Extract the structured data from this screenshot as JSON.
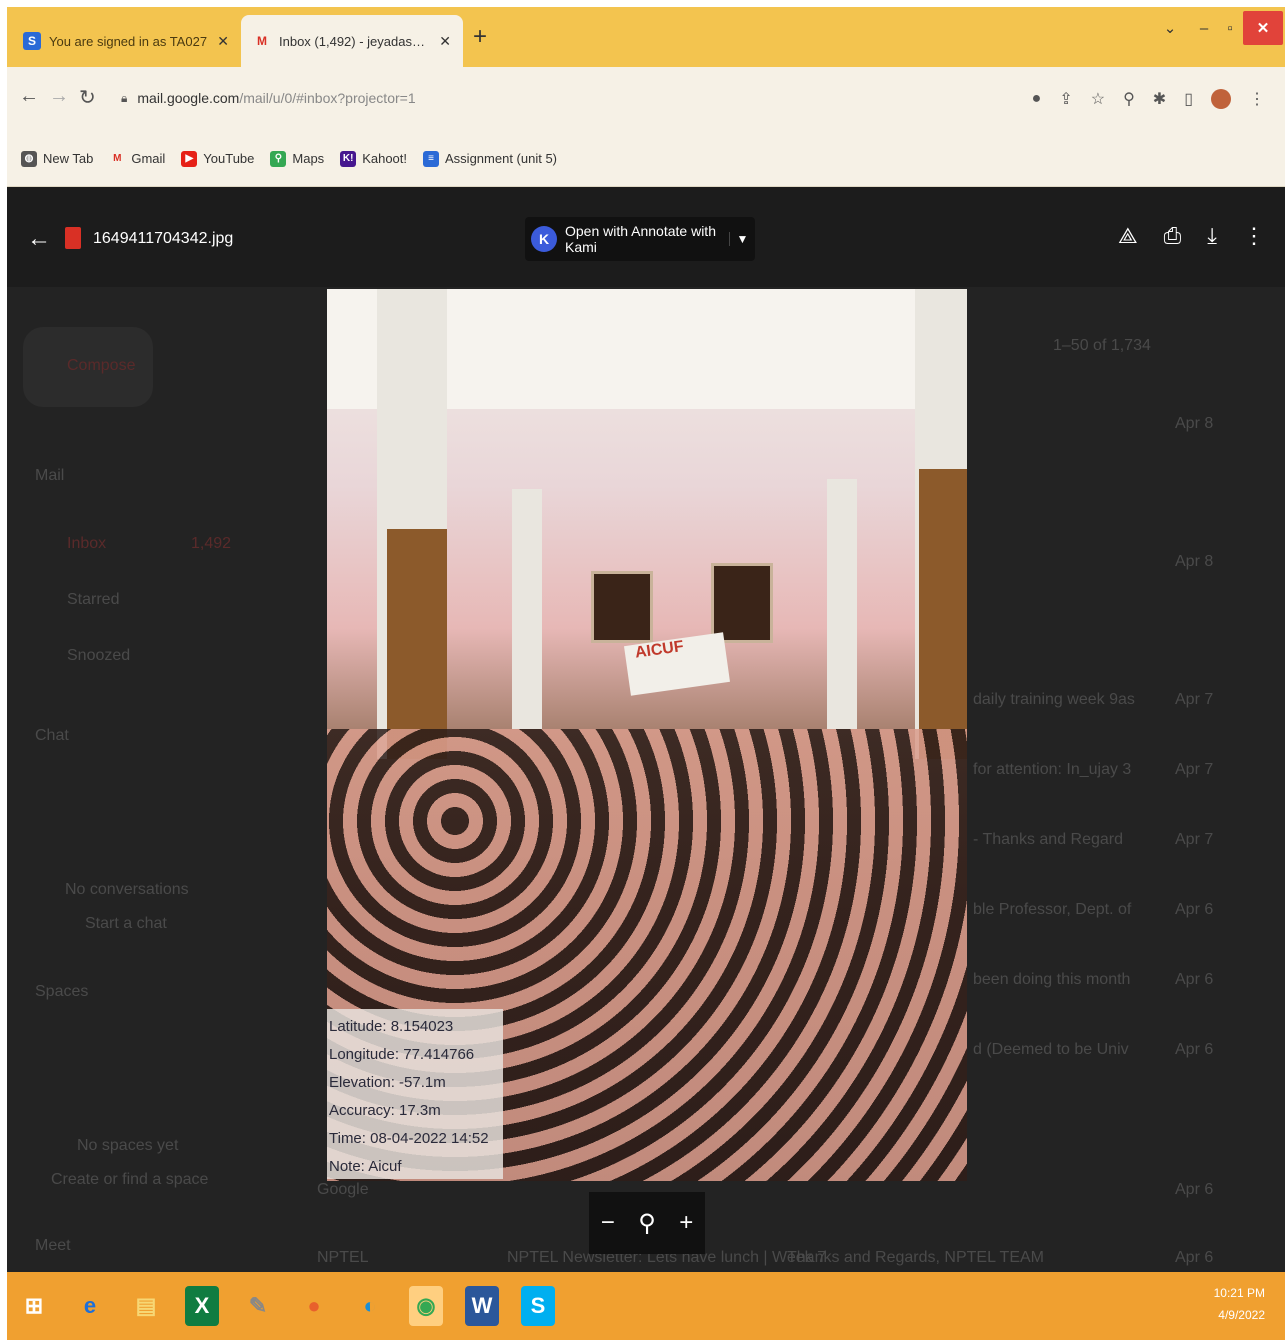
{
  "tabs": [
    {
      "title": "You are signed in as TA027",
      "favicon": "S"
    },
    {
      "title": "Inbox (1,492) - jeyadasy@holy...",
      "favicon": "M"
    }
  ],
  "toolbar": {
    "url_main": "mail.google.com",
    "url_rest": "/mail/u/0/#inbox?projector=1"
  },
  "bookmarks": [
    {
      "label": "New Tab",
      "icon": "globe-icon",
      "color": "#555555"
    },
    {
      "label": "Gmail",
      "icon": "gmail-icon",
      "color": "#d93025"
    },
    {
      "label": "YouTube",
      "icon": "youtube-icon",
      "color": "#e62117"
    },
    {
      "label": "Maps",
      "icon": "maps-icon",
      "color": "#34a853"
    },
    {
      "label": "Kahoot!",
      "icon": "kahoot-icon",
      "color": "#46178f"
    },
    {
      "label": "Assignment (unit 5)",
      "icon": "docs-icon",
      "color": "#2b6ad6"
    }
  ],
  "viewer": {
    "file_name": "1649411704342.jpg",
    "open_with_label": "Open with Annotate with Kami"
  },
  "geotag": {
    "latitude": "Latitude: 8.154023",
    "longitude": "Longitude: 77.414766",
    "elevation": "Elevation: -57.1m",
    "accuracy": "Accuracy: 17.3m",
    "time": "Time: 08-04-2022 14:52",
    "note": "Note: Aicuf"
  },
  "photo": {
    "banner_text": "AICUF"
  },
  "background_gmail": {
    "compose": "Compose",
    "mail": "Mail",
    "inbox": "Inbox",
    "inbox_count": "1,492",
    "starred": "Starred",
    "snoozed": "Snoozed",
    "chat": "Chat",
    "no_conversations": "No conversations",
    "start_chat": "Start a chat",
    "spaces": "Spaces",
    "no_spaces": "No spaces yet",
    "create_space": "Create or find a space",
    "meet": "Meet",
    "pagination": "1–50 of 1,734",
    "dates": [
      "Apr 8",
      "Apr 8",
      "Apr 7",
      "Apr 7",
      "Apr 7",
      "Apr 6",
      "Apr 6",
      "Apr 6",
      "Apr 6",
      "Apr 6"
    ],
    "row_snippets": [
      "daily training week 9as",
      "for attention: In_ujay 3",
      "- Thanks and Regard",
      "ble Professor, Dept. of",
      "been doing this month",
      "d (Deemed to be Univ"
    ],
    "sender_1": "Google",
    "sender_2": "NPTEL",
    "nptel_subject": "NPTEL Newsletter: Lets have lunch | Week 7",
    "nptel_snippet": "Thanks and Regards, NPTEL TEAM"
  },
  "taskbar": {
    "time": "10:21 PM",
    "date": "4/9/2022"
  }
}
